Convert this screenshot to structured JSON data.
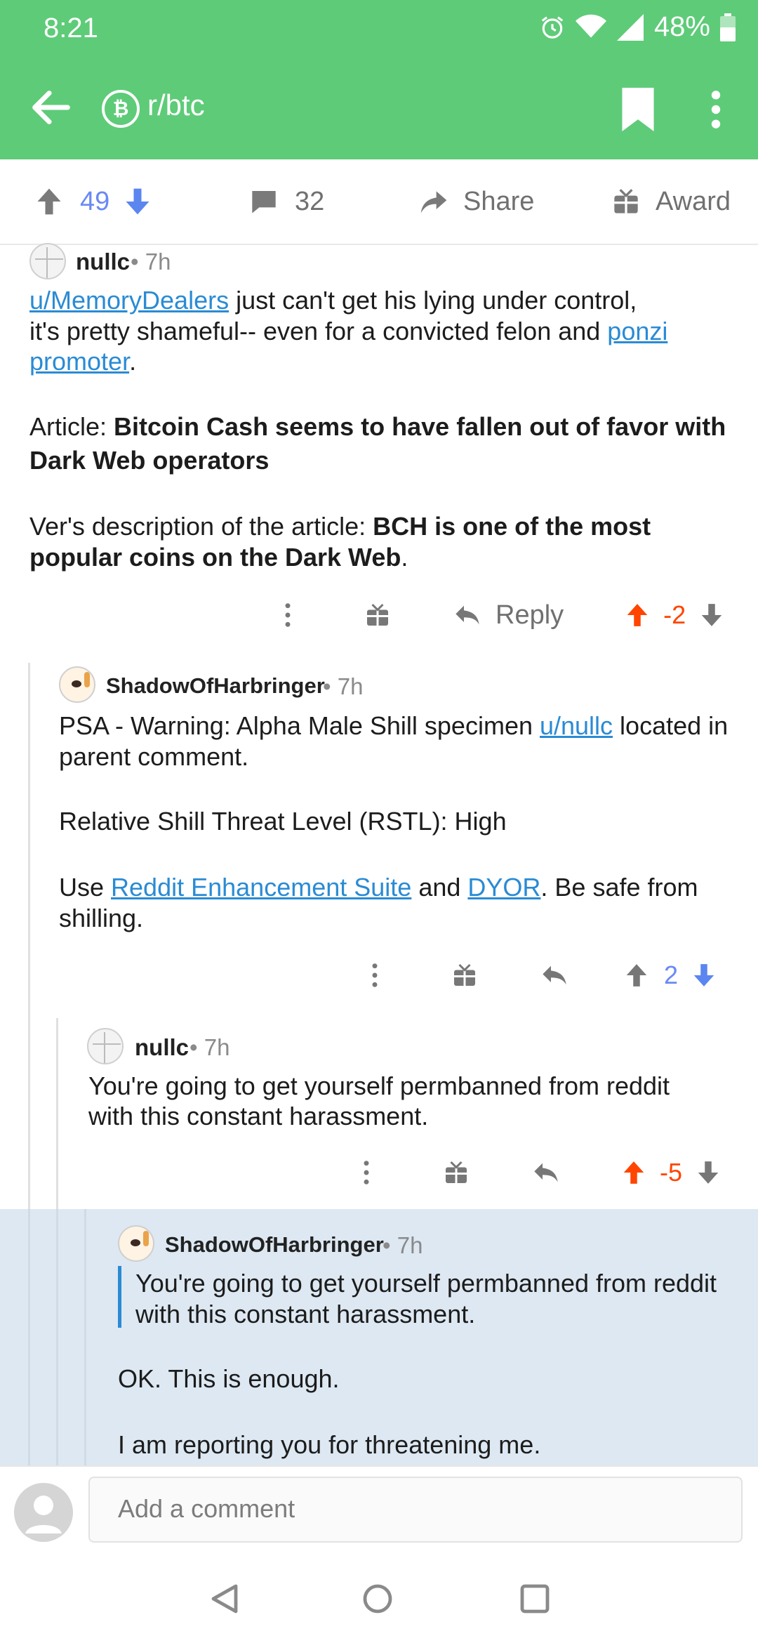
{
  "status": {
    "time": "8:21",
    "battery": "48%"
  },
  "appbar": {
    "subreddit": "r/btc",
    "sub_icon": "bitcoin-icon",
    "colors": {
      "bar": "#5ecb78"
    }
  },
  "actions": {
    "score": "49",
    "comments": "32",
    "share": "Share",
    "award": "Award"
  },
  "comments": {
    "c1": {
      "author": "nullc",
      "age": "• 7h",
      "l1_link": "u/MemoryDealers",
      "l1_text": " just can't get his lying under control,",
      "l2_text": "it's pretty shameful-- even for a convicted felon and ",
      "l2_link": "ponzi",
      "l3_link": "promoter",
      "l3_text": ".",
      "article_label": "Article: ",
      "article_title_1": "Bitcoin Cash seems to have fallen out of favor with",
      "article_title_2": "Dark Web operators",
      "ver_label": "Ver's description of the article: ",
      "ver_quote_1": "BCH is one of the most",
      "ver_quote_2": "popular coins on the Dark Web",
      "ver_end": ".",
      "reply": "Reply",
      "score": "-2"
    },
    "c2": {
      "author": "ShadowOfHarbringer",
      "age": "• 7h",
      "l1_text": "PSA - Warning: Alpha Male Shill specimen ",
      "l1_link": "u/nullc",
      "l1_end": " located in",
      "l2_text": "parent comment.",
      "rstl": "Relative Shill Threat Level (RSTL): High",
      "use_text": "Use ",
      "use_link1": "Reddit Enhancement Suite",
      "use_and": " and ",
      "use_link2": "DYOR",
      "use_end": ". Be safe from",
      "use_l2": "shilling.",
      "score": "2"
    },
    "c3": {
      "author": "nullc",
      "age": "• 7h",
      "l1": "You're going to get yourself permbanned from reddit",
      "l2": "with this constant harassment.",
      "score": "-5"
    },
    "c4": {
      "author": "ShadowOfHarbringer",
      "age": "• 7h",
      "quote_l1": "You're going to get yourself permbanned from reddit",
      "quote_l2": "with this constant harassment.",
      "p1": "OK. This is enough.",
      "p2": "I am reporting you for threatening me."
    }
  },
  "composer": {
    "placeholder": "Add a comment"
  }
}
